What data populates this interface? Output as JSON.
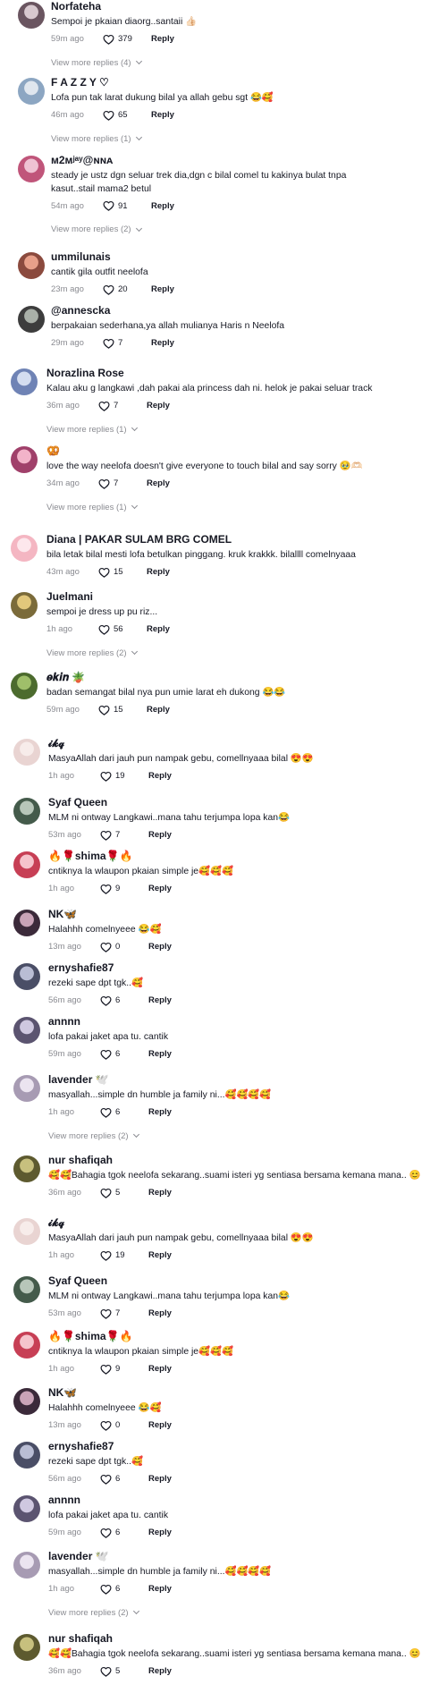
{
  "comments": [
    {
      "name": "Norfateha",
      "text": "Sempoi je pkaian diaorg..santaii 👍🏻",
      "time": "59m ago",
      "likes": "379",
      "reply_label": "Reply",
      "more": "View more replies (4)",
      "avatar": "#6a5560",
      "avatar2": "#d8c9cf"
    },
    {
      "name": "F A Z Z Y ♡",
      "text": "Lofa pun tak larat dukung bilal ya allah gebu sgt 😂🥰",
      "time": "46m ago",
      "likes": "65",
      "reply_label": "Reply",
      "more": "View more replies (1)",
      "avatar": "#8ca6c2",
      "avatar2": "#dfe6ee"
    },
    {
      "name": "ᴍ2ᴍʲᵃʸ@ɴɴᴀ",
      "text": "steady je ustz dgn seluar trek dia,dgn c bilal comel tu kakinya bulat tnpa kasut..stail mama2 betul",
      "time": "54m ago",
      "likes": "91",
      "reply_label": "Reply",
      "more": "View more replies (2)",
      "avatar": "#c0557a",
      "avatar2": "#efc2d3"
    },
    {
      "name": "ummilunais",
      "text": "cantik gila outfit neelofa",
      "time": "23m ago",
      "likes": "20",
      "reply_label": "Reply",
      "avatar": "#8b4a3e",
      "avatar2": "#e8a08a"
    },
    {
      "name": "@annescka",
      "text": "berpakaian sederhana,ya allah mulianya Haris n Neelofa",
      "time": "29m ago",
      "likes": "7",
      "reply_label": "Reply",
      "avatar": "#3d3d3d",
      "avatar2": "#a9b0a8"
    },
    {
      "name": "Norazlina Rose",
      "text": "Kalau aku g langkawi ,dah pakai ala princess dah ni. helok je pakai seluar track",
      "time": "36m ago",
      "likes": "7",
      "reply_label": "Reply",
      "more": "View more replies (1)",
      "avatar": "#6f83b5",
      "avatar2": "#d4ddf0"
    },
    {
      "name": "🥨",
      "text": "love the way neelofa doesn't give everyone to touch bilal and say sorry 🥹🫶🏻",
      "time": "34m ago",
      "likes": "7",
      "reply_label": "Reply",
      "more": "View more replies (1)",
      "avatar": "#a0406a",
      "avatar2": "#f2b3c9"
    },
    {
      "name": "Diana | PAKAR SULAM BRG COMEL",
      "text": "bila letak bilal mesti lofa betulkan pinggang. kruk krakkk. bilallll comelnyaaa",
      "time": "43m ago",
      "likes": "15",
      "reply_label": "Reply",
      "avatar": "#f4b6c2",
      "avatar2": "#fde7ec"
    },
    {
      "name": "Juelmani",
      "text": "sempoi je dress up pu riz...",
      "time": "1h ago",
      "likes": "56",
      "reply_label": "Reply",
      "more": "View more replies (2)",
      "avatar": "#7b6b3a",
      "avatar2": "#e2c77b"
    },
    {
      "name": "𝒆𝒌𝒊𝒏 🪴",
      "text": "badan semangat bilal nya pun umie larat eh dukong 😂😂",
      "time": "59m ago",
      "likes": "15",
      "reply_label": "Reply",
      "avatar": "#4c6b2e",
      "avatar2": "#9fbf6a"
    },
    {
      "name": "𝓲𝓴𝓺",
      "text": "MasyaAllah dari jauh pun nampak gebu, comellnyaaa bilal 😍😍",
      "time": "1h ago",
      "likes": "19",
      "reply_label": "Reply",
      "avatar": "#e9d4d2",
      "avatar2": "#f7ecea"
    },
    {
      "name": "Syaf Queen",
      "text": "MLM ni ontway Langkawi..mana tahu terjumpa lopa kan😂",
      "time": "53m ago",
      "likes": "7",
      "reply_label": "Reply",
      "avatar": "#445b4b",
      "avatar2": "#b7c6b9"
    },
    {
      "name": "🔥🌹shima🌹🔥",
      "text": "cntiknya la wlaupon pkaian simple je🥰🥰🥰",
      "time": "1h ago",
      "likes": "9",
      "reply_label": "Reply",
      "avatar": "#c73f55",
      "avatar2": "#f5c4cc"
    },
    {
      "name": "NK🦋",
      "text": "Halahhh comelnyeee 😂🥰",
      "time": "13m ago",
      "likes": "0",
      "reply_label": "Reply",
      "avatar": "#3b2a3a",
      "avatar2": "#c9a3b7"
    },
    {
      "name": "ernyshafie87",
      "text": "rezeki sape dpt tgk..🥰",
      "time": "56m ago",
      "likes": "6",
      "reply_label": "Reply",
      "avatar": "#4a4e66",
      "avatar2": "#b9bdd4"
    },
    {
      "name": "annnn",
      "text": "lofa pakai jaket apa tu. cantik",
      "time": "59m ago",
      "likes": "6",
      "reply_label": "Reply",
      "avatar": "#5b5470",
      "avatar2": "#cfc8e0"
    },
    {
      "name": "lavender 🕊️",
      "text": "masyallah...simple dn humble ja family ni...🥰🥰🥰🥰",
      "time": "1h ago",
      "likes": "6",
      "reply_label": "Reply",
      "more": "View more replies (2)",
      "avatar": "#a79bb3",
      "avatar2": "#ebe4f0"
    },
    {
      "name": "nur shafiqah",
      "text": "🥰🥰Bahagia tgok neelofa sekarang..suami isteri yg sentiasa bersama kemana mana.. 😊",
      "time": "36m ago",
      "likes": "5",
      "reply_label": "Reply",
      "avatar": "#5d5a2f",
      "avatar2": "#c7c07e"
    },
    {
      "name": "𝓲𝓴𝓺",
      "text": "MasyaAllah dari jauh pun nampak gebu, comellnyaaa bilal 😍😍",
      "time": "1h ago",
      "likes": "19",
      "reply_label": "Reply",
      "avatar": "#e9d4d2",
      "avatar2": "#f7ecea"
    },
    {
      "name": "Syaf Queen",
      "text": "MLM ni ontway Langkawi..mana tahu terjumpa lopa kan😂",
      "time": "53m ago",
      "likes": "7",
      "reply_label": "Reply",
      "avatar": "#445b4b",
      "avatar2": "#b7c6b9"
    },
    {
      "name": "🔥🌹shima🌹🔥",
      "text": "cntiknya la wlaupon pkaian simple je🥰🥰🥰",
      "time": "1h ago",
      "likes": "9",
      "reply_label": "Reply",
      "avatar": "#c73f55",
      "avatar2": "#f5c4cc"
    },
    {
      "name": "NK🦋",
      "text": "Halahhh comelnyeee 😂🥰",
      "time": "13m ago",
      "likes": "0",
      "reply_label": "Reply",
      "avatar": "#3b2a3a",
      "avatar2": "#c9a3b7"
    },
    {
      "name": "ernyshafie87",
      "text": "rezeki sape dpt tgk..🥰",
      "time": "56m ago",
      "likes": "6",
      "reply_label": "Reply",
      "avatar": "#4a4e66",
      "avatar2": "#b9bdd4"
    },
    {
      "name": "annnn",
      "text": "lofa pakai jaket apa tu. cantik",
      "time": "59m ago",
      "likes": "6",
      "reply_label": "Reply",
      "avatar": "#5b5470",
      "avatar2": "#cfc8e0"
    },
    {
      "name": "lavender 🕊️",
      "text": "masyallah...simple dn humble ja family ni...🥰🥰🥰🥰",
      "time": "1h ago",
      "likes": "6",
      "reply_label": "Reply",
      "more": "View more replies (2)",
      "avatar": "#a79bb3",
      "avatar2": "#ebe4f0"
    },
    {
      "name": "nur shafiqah",
      "text": "🥰🥰Bahagia tgok neelofa sekarang..suami isteri yg sentiasa bersama kemana mana.. 😊",
      "time": "36m ago",
      "likes": "5",
      "reply_label": "Reply",
      "avatar": "#5d5a2f",
      "avatar2": "#c7c07e"
    }
  ]
}
